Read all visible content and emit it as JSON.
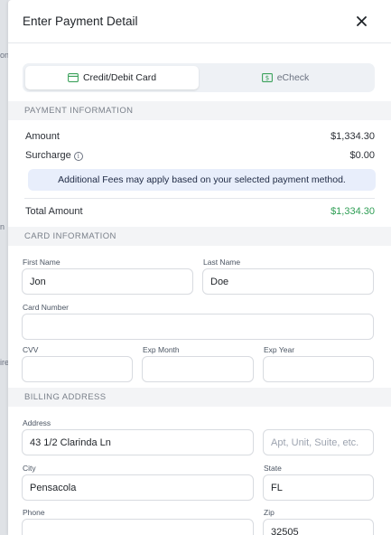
{
  "background": {
    "fragments": [
      "on",
      "n",
      "ire"
    ]
  },
  "header": {
    "title": "Enter Payment Detail",
    "close_icon": "close-icon"
  },
  "tabs": [
    {
      "label": "Credit/Debit Card",
      "icon": "credit-card-icon",
      "active": true
    },
    {
      "label": "eCheck",
      "icon": "check-icon",
      "active": false,
      "color": "#3aa15a"
    }
  ],
  "payment_info": {
    "heading": "PAYMENT INFORMATION",
    "amount_label": "Amount",
    "amount_value": "$1,334.30",
    "surcharge_label": "Surcharge",
    "surcharge_info_icon": "info-icon",
    "surcharge_value": "$0.00",
    "notice": "Additional Fees may apply based on your selected payment method.",
    "total_label": "Total Amount",
    "total_value": "$1,334.30",
    "total_color": "#2f9e55"
  },
  "card_info": {
    "heading": "CARD INFORMATION",
    "first_name_label": "First Name",
    "first_name_value": "Jon",
    "last_name_label": "Last Name",
    "last_name_value": "Doe",
    "card_number_label": "Card Number",
    "card_number_value": "",
    "cvv_label": "CVV",
    "cvv_value": "",
    "exp_month_label": "Exp Month",
    "exp_month_value": "",
    "exp_year_label": "Exp Year",
    "exp_year_value": ""
  },
  "billing": {
    "heading": "BILLING ADDRESS",
    "address_label": "Address",
    "address_value": "43 1/2 Clarinda Ln",
    "apt_placeholder": "Apt, Unit, Suite, etc.",
    "city_label": "City",
    "city_value": "Pensacola",
    "state_label": "State",
    "state_value": "FL",
    "phone_label": "Phone",
    "phone_value": "",
    "zip_label": "Zip",
    "zip_value": "32505"
  }
}
